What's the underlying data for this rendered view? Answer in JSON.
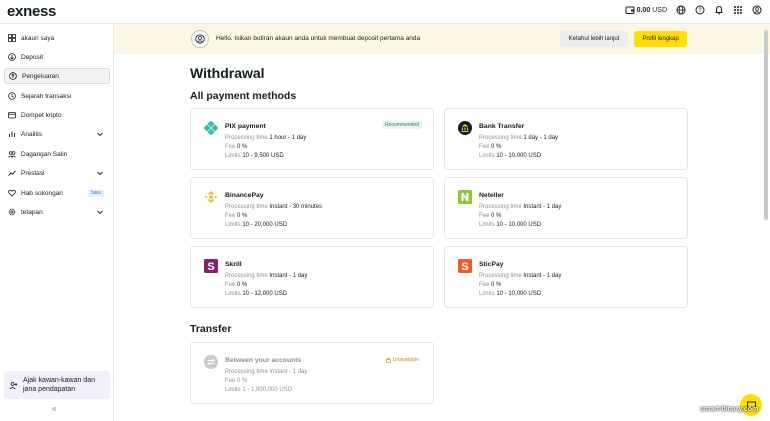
{
  "header": {
    "logo": "exness",
    "balance": "0.00",
    "currency": "USD"
  },
  "sidebar": {
    "items": [
      {
        "label": "akaun saya",
        "icon": "grid-icon"
      },
      {
        "label": "Deposit",
        "icon": "deposit-icon"
      },
      {
        "label": "Pengeluaran",
        "icon": "withdrawal-icon",
        "active": true
      },
      {
        "label": "Sejarah transaksi",
        "icon": "history-icon"
      },
      {
        "label": "Dompet kripto",
        "icon": "wallet-icon"
      },
      {
        "label": "Analitis",
        "icon": "analytics-icon",
        "chevron": true
      },
      {
        "label": "Dagangan Salin",
        "icon": "copy-trade-icon"
      },
      {
        "label": "Prestasi",
        "icon": "performance-icon",
        "chevron": true
      },
      {
        "label": "Hab sokongan",
        "icon": "heart-icon",
        "badge": "baru"
      },
      {
        "label": "tetapan",
        "icon": "gear-icon",
        "chevron": true
      }
    ],
    "invite_label_1": "Ajak kawan-kawan dan",
    "invite_label_2": "jana pendapatan",
    "collapse_glyph": "«"
  },
  "banner": {
    "message": "Hello. Isikan butiran akaun anda untuk membuat deposit pertama anda",
    "learn_more": "Ketahui lebih lanjut",
    "complete_profile": "Profil lengkap"
  },
  "main": {
    "title": "Withdrawal",
    "all_methods_title": "All payment methods",
    "transfer_title": "Transfer",
    "labels": {
      "processing_time": "Processing time",
      "fee": "Fee",
      "limits": "Limits",
      "recommended": "Recommended",
      "unavailable": "Unavailable"
    },
    "methods": [
      {
        "name": "PIX payment",
        "processing": "1 hour - 1 day",
        "fee": "0 %",
        "limits": "10 - 9,500 USD",
        "recommended": true
      },
      {
        "name": "Bank Transfer",
        "processing": "1 day - 1 day",
        "fee": "0 %",
        "limits": "10 - 10,000 USD"
      },
      {
        "name": "BinancePay",
        "processing": "Instant - 30 minutes",
        "fee": "0 %",
        "limits": "10 - 20,000 USD"
      },
      {
        "name": "Neteller",
        "processing": "Instant - 1 day",
        "fee": "0 %",
        "limits": "10 - 10,000 USD"
      },
      {
        "name": "Skrill",
        "processing": "Instant - 1 day",
        "fee": "0 %",
        "limits": "10 - 12,000 USD"
      },
      {
        "name": "SticPay",
        "processing": "Instant - 1 day",
        "fee": "0 %",
        "limits": "10 - 10,000 USD"
      }
    ],
    "transfer": {
      "name": "Between your accounts",
      "processing": "Instant - 1 day",
      "fee": "0 %",
      "limits": "1 - 1,000,000 USD"
    }
  },
  "watermark": "smart-binary.com",
  "colors": {
    "accent_yellow": "#ffde02",
    "banner_bg": "#fcf7e5",
    "recommended_green": "#2b8a5a",
    "unavailable_orange": "#d4880f"
  }
}
